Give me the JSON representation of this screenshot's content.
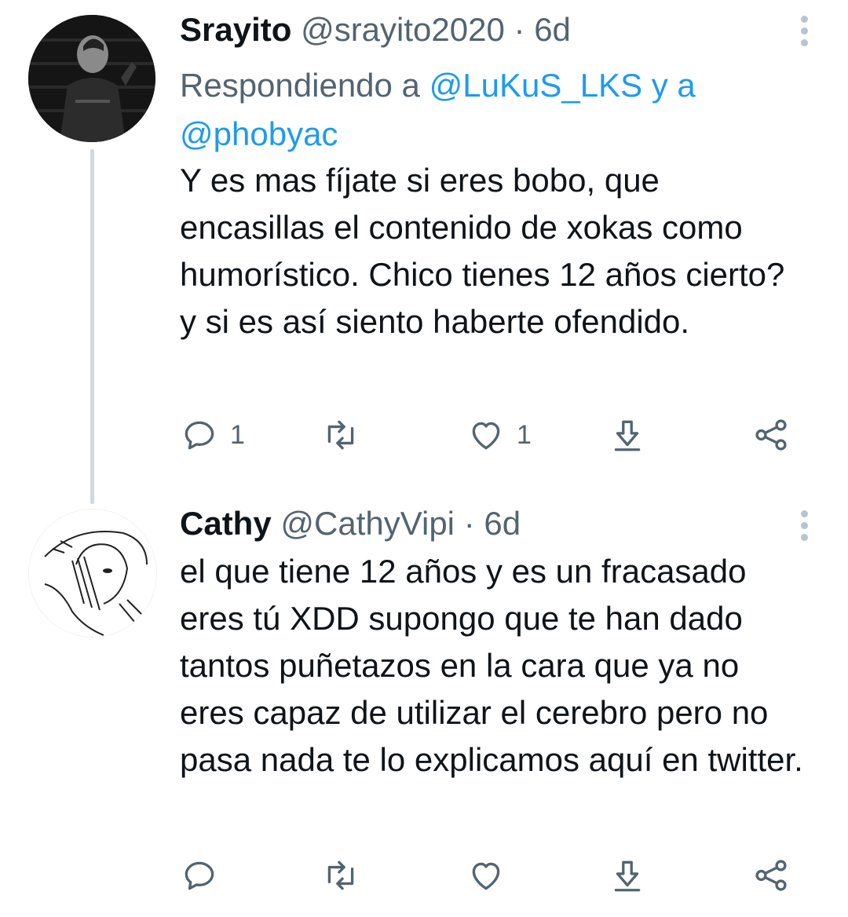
{
  "tweets": [
    {
      "name": "Srayito",
      "handle": "@srayito2020",
      "separator": "·",
      "time": "6d",
      "reply_prefix": "Respondiendo a",
      "reply_users": [
        "@LuKuS_LKS",
        "@phobyac"
      ],
      "reply_joiner": "y a",
      "text": "Y es mas fíjate si eres bobo, que encasillas el contenido de xokas como humorístico. Chico tienes 12 años cierto? y si es así siento haberte ofendido.",
      "replies": "1",
      "retweets": "",
      "likes": "1",
      "avatar_icon": "avatar-man-photo"
    },
    {
      "name": "Cathy",
      "handle": "@CathyVipi",
      "separator": "·",
      "time": "6d",
      "text": "el que tiene 12 años y es un fracasado eres tú XDD supongo que te han dado tantos puñetazos en la cara que ya no eres capaz de utilizar el cerebro pero no pasa nada te lo explicamos aquí en twitter.",
      "replies": "",
      "retweets": "",
      "likes": "",
      "avatar_icon": "avatar-sketch-drawing"
    }
  ],
  "icons": {
    "reply": "reply-icon",
    "retweet": "retweet-icon",
    "like": "heart-icon",
    "save": "download-icon",
    "share": "share-icon",
    "more": "more-options-icon"
  },
  "colors": {
    "link": "#1d9bf0",
    "muted": "#536471",
    "text": "#0f1419",
    "thread_line": "#cfd9de"
  }
}
